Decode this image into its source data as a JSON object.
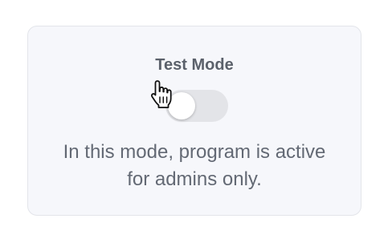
{
  "card": {
    "title": "Test Mode",
    "toggle": {
      "state": "off"
    },
    "description_lines": [
      "In this mode, program is active",
      "for admins only."
    ]
  },
  "cursor": {
    "icon": "hand-pointer-icon"
  },
  "colors": {
    "card_background": "#f6f7fb",
    "card_border": "#e3e5ea",
    "title_text": "#5b616b",
    "body_text": "#636974",
    "toggle_track": "#e3e4e8",
    "toggle_knob": "#ffffff"
  }
}
